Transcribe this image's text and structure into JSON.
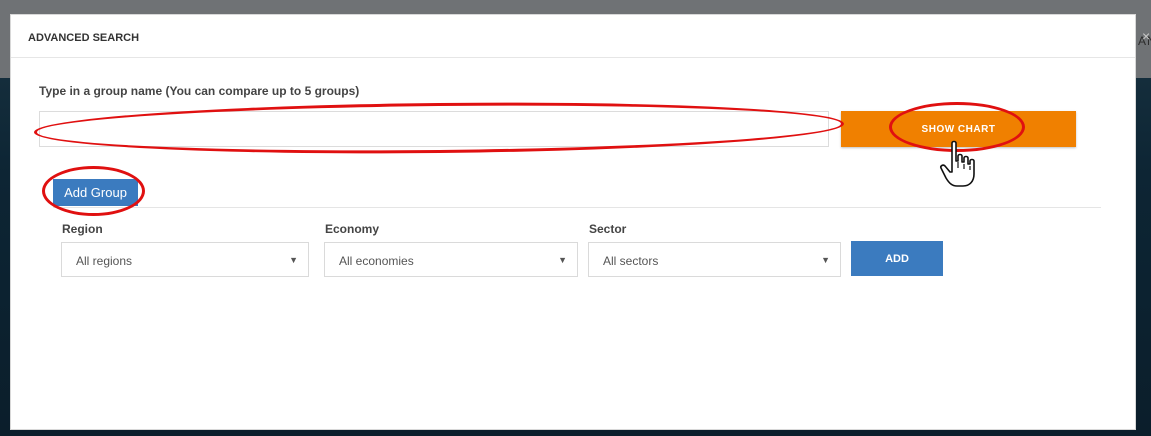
{
  "background": {
    "edge_text": "AN"
  },
  "modal": {
    "title": "ADVANCED SEARCH",
    "close_symbol": "×",
    "instruction": "Type in a group name (You can compare up to 5 groups)",
    "group_input": {
      "value": "",
      "placeholder": ""
    },
    "show_chart_label": "SHOW CHART",
    "add_group_label": "Add Group",
    "filters": {
      "region": {
        "label": "Region",
        "value": "All regions"
      },
      "economy": {
        "label": "Economy",
        "value": "All economies"
      },
      "sector": {
        "label": "Sector",
        "value": "All sectors"
      }
    },
    "add_label": "ADD"
  },
  "colors": {
    "primary_blue": "#3b7bbf",
    "accent_orange": "#f08000",
    "annotation_red": "#e01010"
  },
  "icons": {
    "close": "close-icon",
    "caret": "chevron-down-icon",
    "cursor": "hand-pointer-icon"
  }
}
